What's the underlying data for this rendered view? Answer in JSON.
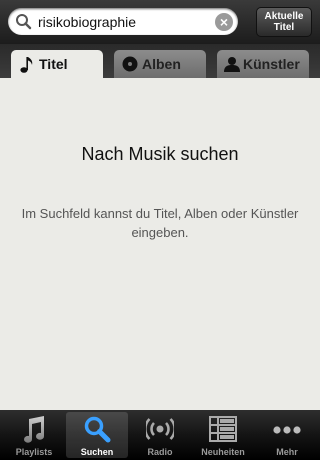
{
  "search": {
    "value": "risikobiographie",
    "clear_icon": "clear-icon",
    "now_playing_label": "Aktuelle\nTitel"
  },
  "tabs": [
    {
      "label": "Titel",
      "icon": "music-note-icon",
      "active": true
    },
    {
      "label": "Alben",
      "icon": "disc-icon",
      "active": false
    },
    {
      "label": "Künstler",
      "icon": "person-icon",
      "active": false
    }
  ],
  "main": {
    "heading": "Nach Musik suchen",
    "hint": "Im Suchfeld kannst du Titel, Alben oder Künstler eingeben."
  },
  "tabbar": [
    {
      "label": "Playlists",
      "icon": "music-notes-icon",
      "active": false
    },
    {
      "label": "Suchen",
      "icon": "search-icon",
      "active": true
    },
    {
      "label": "Radio",
      "icon": "radio-icon",
      "active": false
    },
    {
      "label": "Neuheiten",
      "icon": "list-icon",
      "active": false
    },
    {
      "label": "Mehr",
      "icon": "more-icon",
      "active": false
    }
  ],
  "colors": {
    "background": "#ebebe7",
    "tab_bar": "#141414",
    "active_tab": "#ebebe7"
  }
}
